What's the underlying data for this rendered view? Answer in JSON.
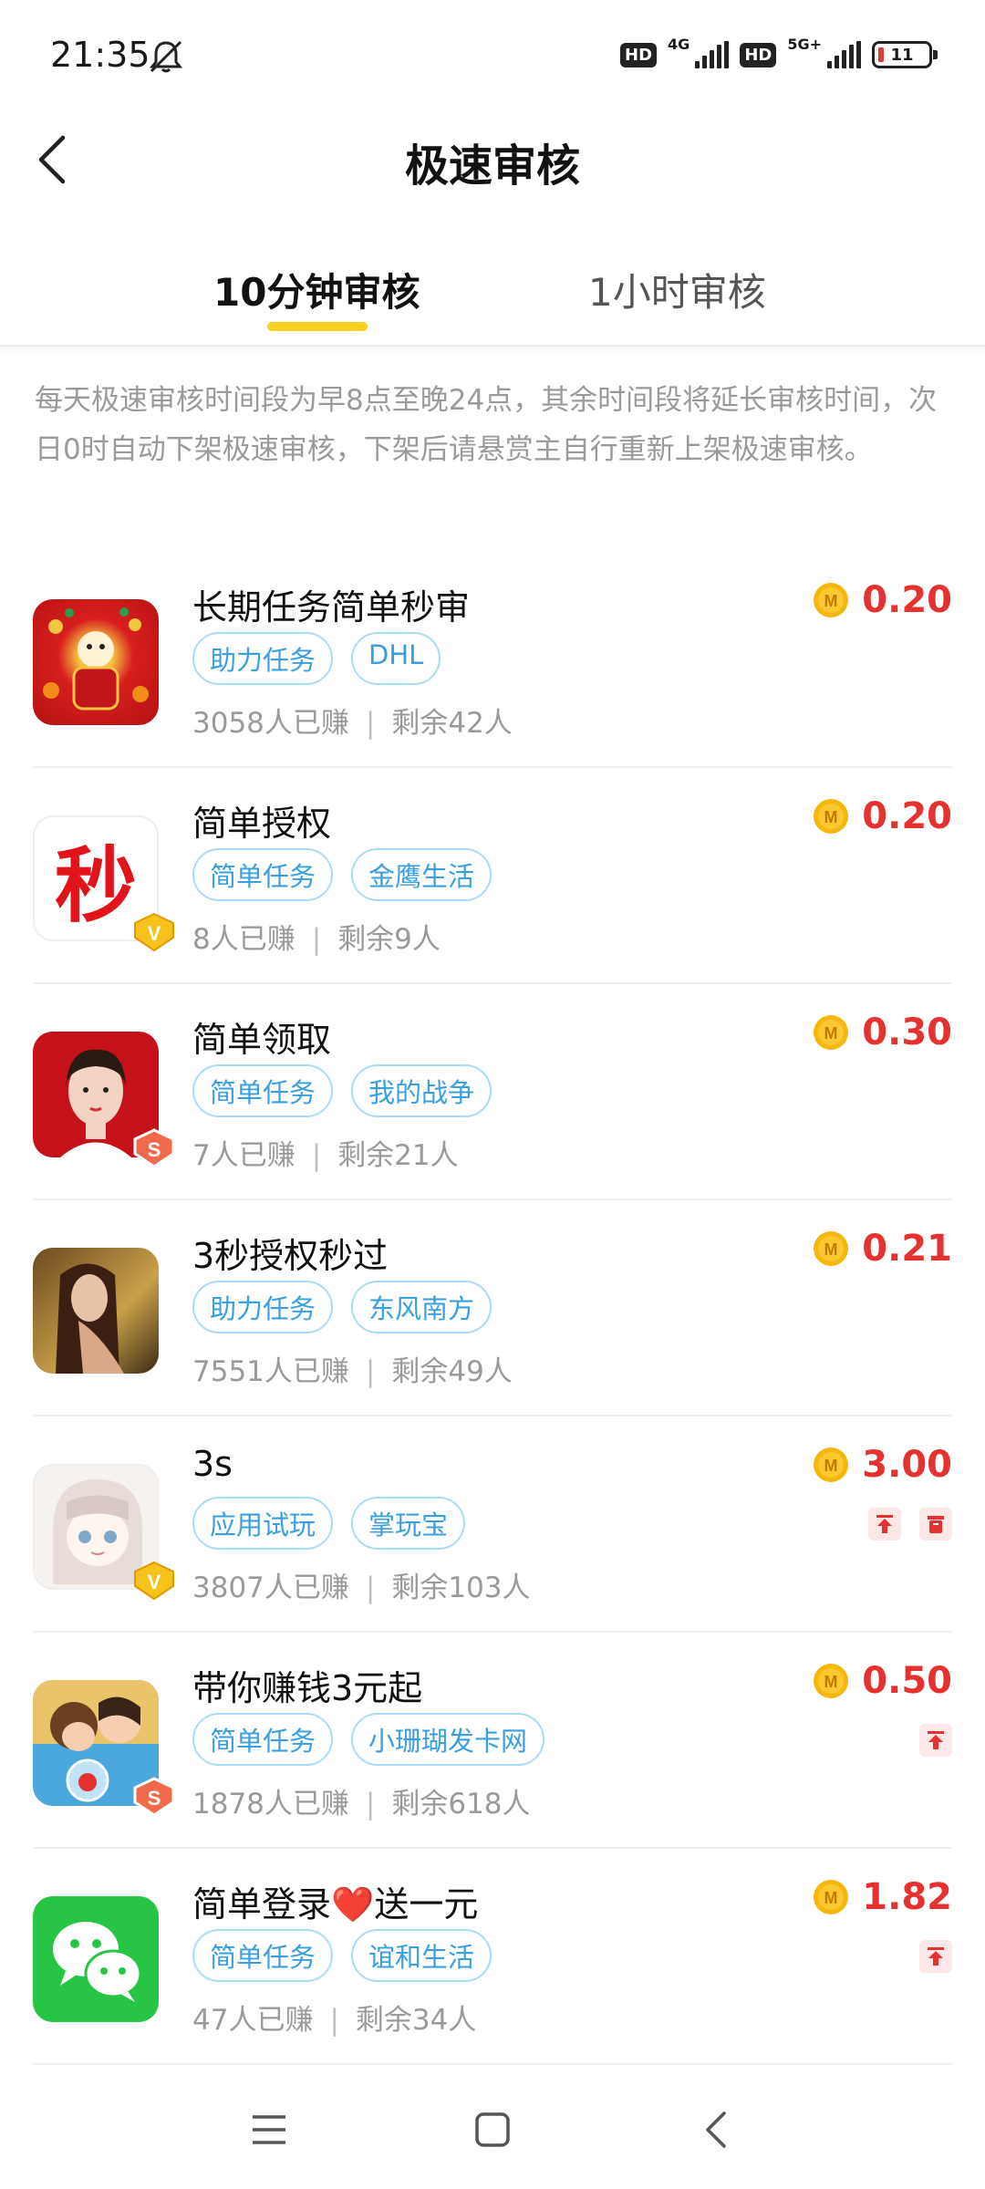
{
  "status_bar": {
    "time": "21:35",
    "hd_label": "HD",
    "net1": "4G",
    "net2": "5G+",
    "battery": "11"
  },
  "header": {
    "title": "极速审核"
  },
  "tabs": [
    {
      "label": "10分钟审核",
      "active": true
    },
    {
      "label": "1小时审核",
      "active": false
    }
  ],
  "notice": "每天极速审核时间段为早8点至晚24点，其余时间段将延长审核时间，次日0时自动下架极速审核，下架后请悬赏主自行重新上架极速审核。",
  "tasks": [
    {
      "title": "长期任务简单秒审",
      "tags": [
        "助力任务",
        "DHL"
      ],
      "earned": "3058人已赚",
      "remaining": "剩余42人",
      "reward": "0.20",
      "avatar": "festival-avatar",
      "badge": "",
      "actions": []
    },
    {
      "title": "简单授权",
      "tags": [
        "简单任务",
        "金鹰生活"
      ],
      "earned": "8人已赚",
      "remaining": "剩余9人",
      "reward": "0.20",
      "avatar": "miao-avatar",
      "avatar_text": "秒",
      "badge": "V",
      "actions": []
    },
    {
      "title": "简单领取",
      "tags": [
        "简单任务",
        "我的战争"
      ],
      "earned": "7人已赚",
      "remaining": "剩余21人",
      "reward": "0.30",
      "avatar": "portrait-red-avatar",
      "badge": "S",
      "actions": []
    },
    {
      "title": "3秒授权秒过",
      "tags": [
        "助力任务",
        "东风南方"
      ],
      "earned": "7551人已赚",
      "remaining": "剩余49人",
      "reward": "0.21",
      "avatar": "portrait-dark-avatar",
      "badge": "",
      "actions": []
    },
    {
      "title": "3s",
      "tags": [
        "应用试玩",
        "掌玩宝"
      ],
      "earned": "3807人已赚",
      "remaining": "剩余103人",
      "reward": "3.00",
      "avatar": "anime-girl-avatar",
      "badge": "V",
      "actions": [
        "top-icon",
        "trash-icon"
      ]
    },
    {
      "title": "带你赚钱3元起",
      "tags": [
        "简单任务",
        "小珊瑚发卡网"
      ],
      "earned": "1878人已赚",
      "remaining": "剩余618人",
      "reward": "0.50",
      "avatar": "cartoon-kiss-avatar",
      "badge": "S",
      "actions": [
        "top-icon"
      ]
    },
    {
      "title": "简单登录❤️送一元",
      "tags": [
        "简单任务",
        "谊和生活"
      ],
      "earned": "47人已赚",
      "remaining": "剩余34人",
      "reward": "1.82",
      "avatar": "wechat-avatar",
      "badge": "",
      "actions": [
        "top-icon"
      ]
    }
  ],
  "coin_label": "M",
  "colors": {
    "accent": "#f7d21f",
    "reward": "#e5312f",
    "tag_text": "#3a9fe0",
    "tag_border": "#a9dbf5"
  }
}
